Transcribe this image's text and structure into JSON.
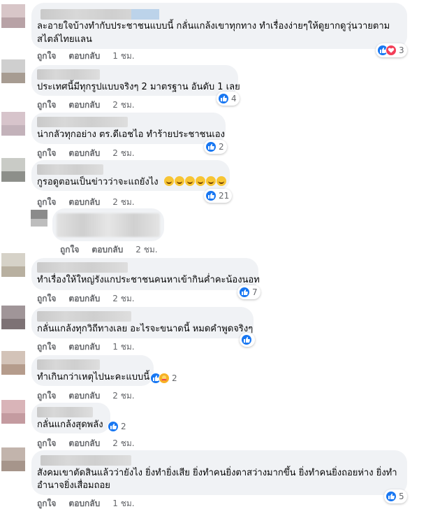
{
  "action_labels": {
    "like": "ถูกใจ",
    "reply": "ตอบกลับ"
  },
  "colors": {
    "bubble": "#f0f2f5",
    "like_blue": "#1877f2",
    "love_red": "#f33e58",
    "care_yellow": "#f7b125",
    "meta_gray": "#65676b"
  },
  "comments": [
    {
      "lines": [
        "ละอายใจบ้างทำกับประชาชนแบบนี้ กลั่นแกล้งเขาทุกทาง ทำเรื่องง่ายๆให้ดูยากดูวุ่นวายตาม",
        "สไตล์ไทยแลน"
      ],
      "time": "1 ชม.",
      "reactions": [
        "like-icon",
        "love-icon"
      ],
      "count": "3"
    },
    {
      "lines": [
        "ประเทศนี้มีทุกรูปแบบจริงๆ 2 มาตรฐาน อันดับ 1 เลย"
      ],
      "time": "2 ชม.",
      "reactions": [
        "like-icon"
      ],
      "count": "4"
    },
    {
      "lines": [
        "น่ากลัวทุกอย่าง ตร.ดีเอชไอ ทำร้ายประชาชนเอง"
      ],
      "time": "2 ชม.",
      "reactions": [
        "like-icon"
      ],
      "count": "2"
    },
    {
      "lines": [
        "กูรอดูตอนเป็นข่าวว่าจะแถยังไง"
      ],
      "emoji_count": 6,
      "time": "2 ชม.",
      "reactions": [
        "like-icon"
      ],
      "count": "21"
    },
    {
      "lines": [],
      "time": "2 ชม.",
      "reactions": [],
      "count": ""
    },
    {
      "lines": [
        "ทำเรื่องให้ใหญ่รังแกประชาชนคนหาเข้ากินค่ำคะน้องนอท"
      ],
      "time": "2 ชม.",
      "reactions": [
        "like-icon"
      ],
      "count": "7"
    },
    {
      "lines": [
        "กลั่นแกล้งทุกวิถีทางเลย อะไรจะขนาดนี้ หมดคำพูดจริงๆ"
      ],
      "time": "1 ชม.",
      "reactions": [
        "like-icon"
      ],
      "count": ""
    },
    {
      "lines": [
        "ทำเกินกว่าเหตุไปนะคะแบบนี้"
      ],
      "time": "2 ชม.",
      "reactions": [
        "like-icon",
        "care-icon"
      ],
      "count": "2"
    },
    {
      "lines": [
        "กลั่นแกล้งสุดพลัง"
      ],
      "time": "2 ชม.",
      "reactions": [
        "like-icon"
      ],
      "count": "2"
    },
    {
      "lines": [
        "สังคมเขาตัดสินแล้วว่ายังไง ยิ่งทำยิ่งเสีย ยิ่งทำคนยิ่งตาสว่างมากขึ้น ยิ่งทำคนยิ่งถอยห่าง ยิ่งทำ",
        "อำนาจยิ่งเสื่อมถอย"
      ],
      "time": "1 ชม.",
      "reactions": [
        "like-icon"
      ],
      "count": "5"
    }
  ]
}
